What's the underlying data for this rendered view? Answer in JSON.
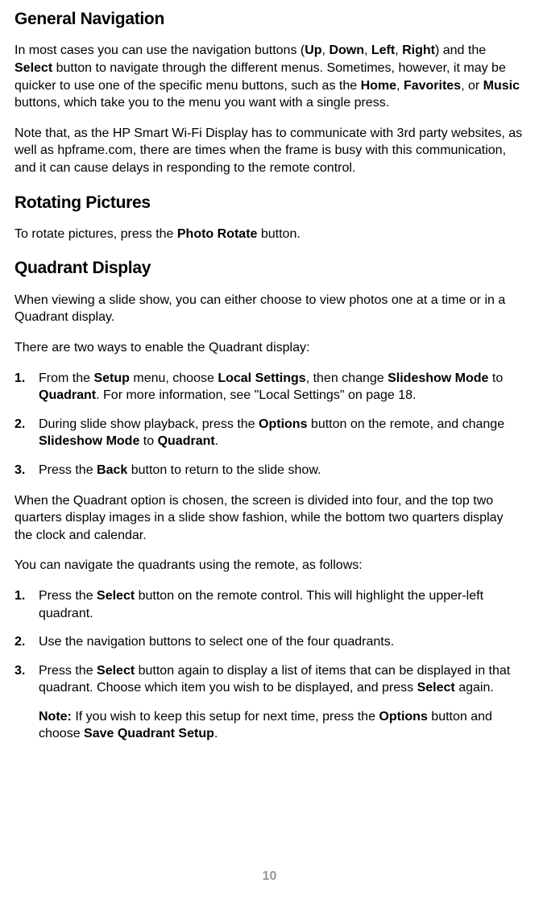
{
  "sections": {
    "general_navigation": {
      "heading": "General Navigation",
      "p1_parts": [
        "In most cases you can use the navigation buttons (",
        "Up",
        ", ",
        "Down",
        ", ",
        "Left",
        ", ",
        "Right",
        ") and the ",
        "Select",
        " button to navigate through the different menus. Sometimes, however, it may be quicker to use one of the specific menu buttons, such as the ",
        "Home",
        ", ",
        "Favorites",
        ", or ",
        "Music",
        " buttons, which take you to the menu you want with a single press."
      ],
      "p2": "Note that, as the HP Smart Wi-Fi Display has to communicate with 3rd party websites, as well as hpframe.com, there are times when the frame is busy with this communication, and it can cause delays in responding to the remote control."
    },
    "rotating_pictures": {
      "heading": "Rotating Pictures",
      "p1_parts": [
        "To rotate pictures, press the ",
        "Photo Rotate",
        " button."
      ]
    },
    "quadrant_display": {
      "heading": "Quadrant Display",
      "p1": "When viewing a slide show, you can either choose to view photos one at a time or in a Quadrant display.",
      "p2": "There are two ways to enable the Quadrant display:",
      "list1": {
        "i1": [
          "From the ",
          "Setup",
          " menu, choose ",
          "Local Settings",
          ", then change ",
          "Slideshow Mode",
          " to ",
          "Quadrant",
          ". For more information, see \"Local Settings\" on page 18."
        ],
        "i2": [
          "During slide show playback, press the ",
          "Options",
          " button on the remote, and change ",
          "Slideshow Mode",
          " to ",
          "Quadrant",
          "."
        ],
        "i3": [
          "Press the ",
          "Back",
          " button to return to the slide show."
        ]
      },
      "p3": "When the Quadrant option is chosen, the screen is divided into four, and the top two quarters display images in a slide show fashion, while the bottom two quarters display the clock and calendar.",
      "p4": "You can navigate the quadrants using the remote, as follows:",
      "list2": {
        "i1": [
          "Press the ",
          "Select",
          " button on the remote control. This will highlight the upper-left quadrant."
        ],
        "i2": [
          "Use the navigation buttons to select one of the four quadrants."
        ],
        "i3": [
          "Press the ",
          "Select",
          " button again to display a list of items that can be displayed in that quadrant. Choose which item you wish to be displayed, and press ",
          "Select",
          " again."
        ]
      },
      "note": [
        "Note:",
        " If you wish to keep this setup for next time, press the ",
        "Options",
        " button and choose ",
        "Save Quadrant Setup",
        "."
      ]
    }
  },
  "page_number": "10"
}
